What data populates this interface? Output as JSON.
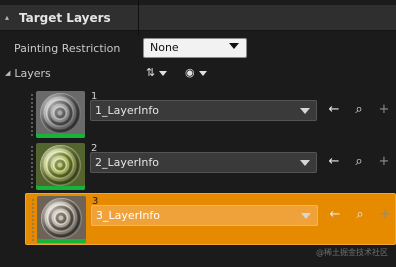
{
  "header": {
    "title": "Target Layers"
  },
  "settings": {
    "painting_restriction_label": "Painting Restriction",
    "painting_restriction_value": "None",
    "layers_label": "Layers"
  },
  "layers": [
    {
      "number": "1",
      "name": "1_LayerInfo",
      "selected": false,
      "texture_color": "#777777"
    },
    {
      "number": "2",
      "name": "2_LayerInfo",
      "selected": false,
      "texture_color": "#879149"
    },
    {
      "number": "3",
      "name": "3_LayerInfo",
      "selected": true,
      "texture_color": "#878079"
    }
  ],
  "icons": {
    "header_caret": "▴",
    "layers_caret": "◢",
    "sort": "⇅",
    "eye": "◉",
    "back": "←",
    "find": "⌕",
    "add": "+"
  },
  "colors": {
    "selected_row": "#e68a00",
    "selected_field": "#f0a23a",
    "thumbnail_stripe": "#18b43a"
  },
  "watermark": "@稀土掘金技术社区"
}
